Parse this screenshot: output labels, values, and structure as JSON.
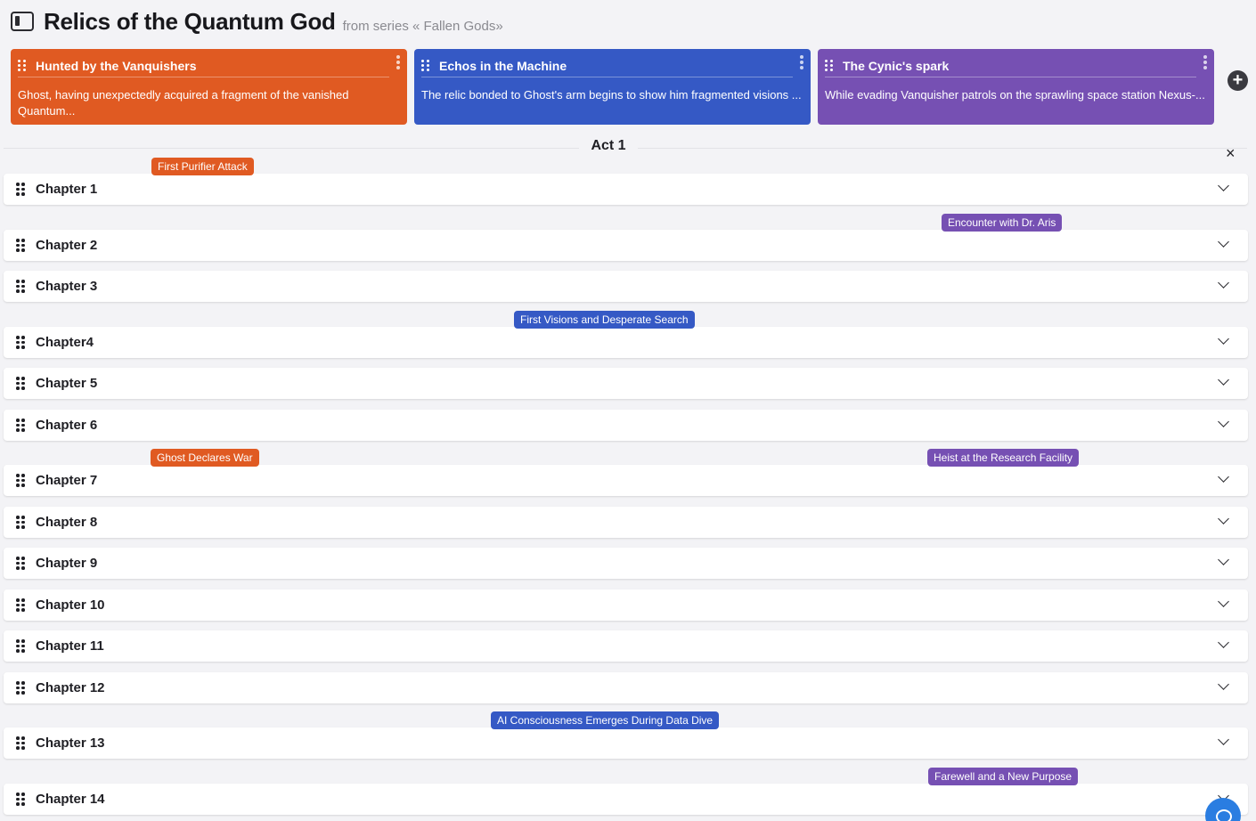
{
  "header": {
    "title": "Relics of the Quantum God",
    "series": "from series « Fallen Gods»"
  },
  "threads": [
    {
      "title": "Hunted by the Vanquishers",
      "description": "Ghost, having unexpectedly acquired a fragment of the vanished Quantum...",
      "color": "#e05a22"
    },
    {
      "title": "Echos in the Machine",
      "description": "The relic bonded to Ghost's arm begins to show him fragmented visions ...",
      "color": "#3559c5"
    },
    {
      "title": "The Cynic's spark",
      "description": "While evading Vanquisher patrols on the sprawling space station Nexus-...",
      "color": "#7650b3"
    }
  ],
  "act": {
    "title": "Act 1",
    "close": "×"
  },
  "chapters": [
    "Chapter 1",
    "Chapter 2",
    "Chapter 3",
    "Chapter4",
    "Chapter 5",
    "Chapter 6",
    "Chapter 7",
    "Chapter 8",
    "Chapter 9",
    "Chapter 10",
    "Chapter 11",
    "Chapter 12",
    "Chapter 13",
    "Chapter 14"
  ],
  "plot_points": [
    {
      "label": "First Purifier Attack",
      "chapter": "Chapter 1",
      "thread": "Hunted by the Vanquishers"
    },
    {
      "label": "Encounter with Dr. Aris",
      "chapter": "Chapter 2",
      "thread": "The Cynic's spark"
    },
    {
      "label": "First Visions and Desperate Search",
      "chapter": "Chapter4",
      "thread": "Echos in the Machine"
    },
    {
      "label": "Ghost Declares War",
      "chapter": "Chapter 7",
      "thread": "Hunted by the Vanquishers"
    },
    {
      "label": "Heist at the Research Facility",
      "chapter": "Chapter 7",
      "thread": "The Cynic's spark"
    },
    {
      "label": "AI Consciousness Emerges During Data Dive",
      "chapter": "Chapter 13",
      "thread": "Echos in the Machine"
    },
    {
      "label": "Farewell and a New Purpose",
      "chapter": "Chapter 14",
      "thread": "The Cynic's spark"
    }
  ]
}
